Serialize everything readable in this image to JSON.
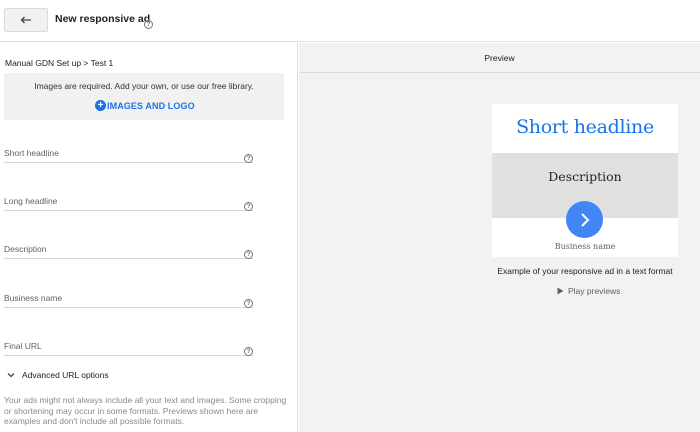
{
  "header": {
    "title": "New responsive ad",
    "back_icon": "back-arrow-icon",
    "help_icon": "help-circle-icon"
  },
  "form": {
    "breadcrumb": "Manual GDN Set up > Test 1",
    "images": {
      "note": "Images are required. Add your own, or use our free library.",
      "action_label": "IMAGES AND LOGO",
      "action_icon": "plus-circle-icon"
    },
    "fields": [
      {
        "label": "Short headline",
        "value": ""
      },
      {
        "label": "Long headline",
        "value": ""
      },
      {
        "label": "Description",
        "value": ""
      },
      {
        "label": "Business name",
        "value": ""
      },
      {
        "label": "Final URL",
        "value": ""
      }
    ],
    "advanced_label": "Advanced URL options",
    "disclaimer": "Your ads might not always include all your text and images. Some cropping or shortening may occur in some formats. Previews shown here are examples and don't include all possible formats."
  },
  "preview": {
    "header": "Preview",
    "ad": {
      "headline": "Short headline",
      "description": "Description",
      "business_name": "Business name"
    },
    "caption": "Example of your responsive ad in a text format",
    "play_label": "Play previews"
  },
  "colors": {
    "accent": "#1a73e8",
    "arrow_button": "#4285f4",
    "preview_bg": "#f2f2f2"
  }
}
